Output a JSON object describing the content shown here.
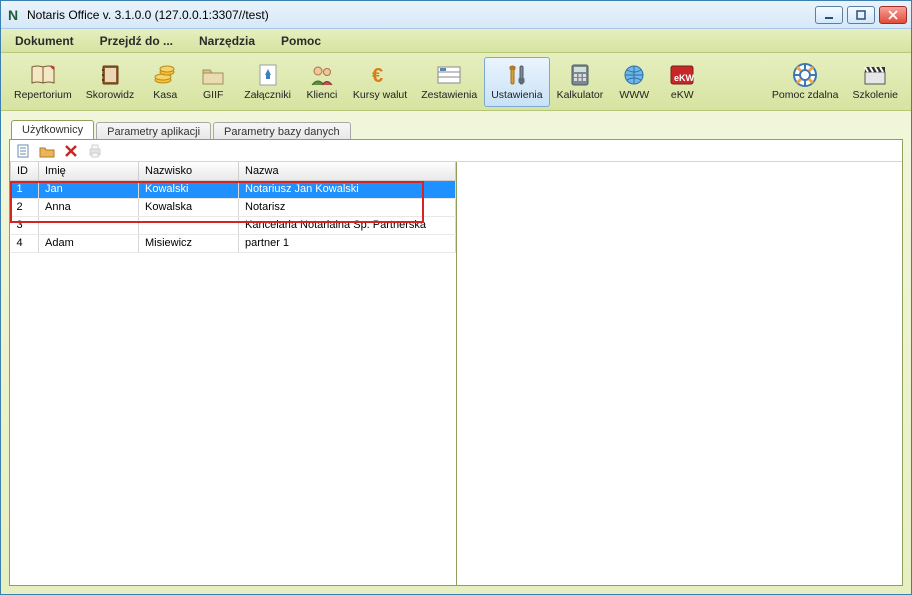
{
  "title": "Notaris Office v. 3.1.0.0 (127.0.0.1:3307//test)",
  "menu": {
    "dokument": "Dokument",
    "przejdz": "Przejdź do ...",
    "narzedzia": "Narzędzia",
    "pomoc": "Pomoc"
  },
  "toolbar": {
    "repertorium": "Repertorium",
    "skorowidz": "Skorowidz",
    "kasa": "Kasa",
    "giif": "GIIF",
    "zalaczniki": "Załączniki",
    "klienci": "Klienci",
    "kursy": "Kursy walut",
    "zestawienia": "Zestawienia",
    "ustawienia": "Ustawienia",
    "kalkulator": "Kalkulator",
    "www": "WWW",
    "ekw": "eKW",
    "pomoc_zdalna": "Pomoc zdalna",
    "szkolenie": "Szkolenie"
  },
  "tabs": {
    "uzytkownicy": "Użytkownicy",
    "parametry_aplikacji": "Parametry aplikacji",
    "parametry_bazy": "Parametry bazy danych"
  },
  "table": {
    "headers": {
      "id": "ID",
      "imie": "Imię",
      "nazwisko": "Nazwisko",
      "nazwa": "Nazwa"
    },
    "rows": [
      {
        "id": "1",
        "imie": "Jan",
        "nazwisko": "Kowalski",
        "nazwa": "Notariusz Jan Kowalski"
      },
      {
        "id": "2",
        "imie": "Anna",
        "nazwisko": "Kowalska",
        "nazwa": "Notarisz"
      },
      {
        "id": "3",
        "imie": "",
        "nazwisko": "",
        "nazwa": "Kancelaria Notarialna Sp. Partnerska"
      },
      {
        "id": "4",
        "imie": "Adam",
        "nazwisko": "Misiewicz",
        "nazwa": "partner 1"
      }
    ]
  }
}
